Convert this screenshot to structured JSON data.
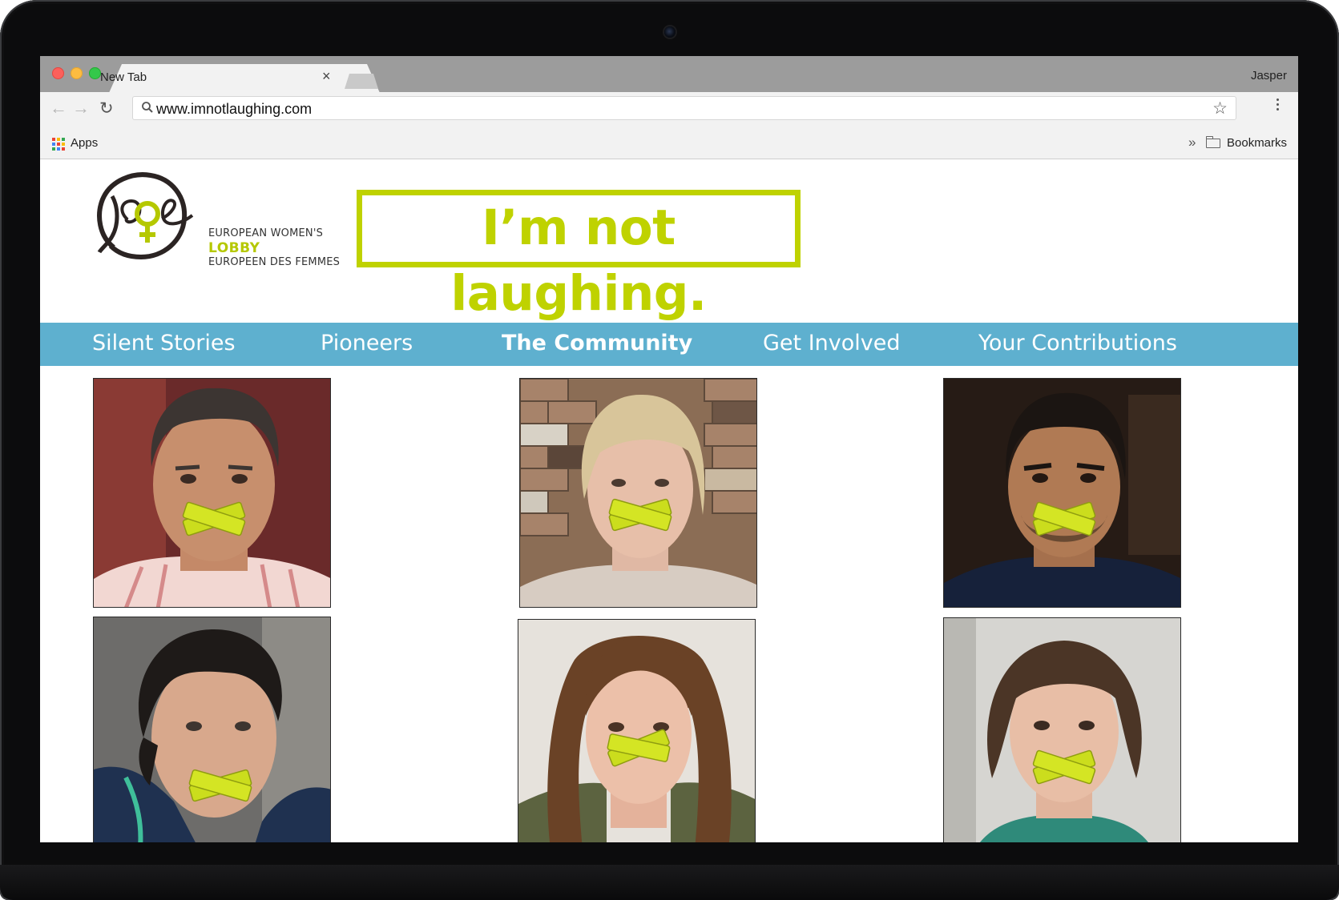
{
  "browser": {
    "tab_title": "New Tab",
    "tab_close": "×",
    "profile_name": "Jasper",
    "url": "www.imnotlaughing.com",
    "bookmarks_apps": "Apps",
    "bookmarks_overflow": "»",
    "bookmarks_folder": "Bookmarks"
  },
  "site": {
    "org_line1": "EUROPEAN WOMEN'S",
    "org_line2": "LOBBY",
    "org_line3": "EUROPEEN DES FEMMES",
    "tagline": "I’m not laughing.",
    "accent_color": "#bfd200",
    "nav_color": "#5eb0cf",
    "nav": [
      {
        "label": "Silent Stories",
        "active": false
      },
      {
        "label": "Pioneers",
        "active": false
      },
      {
        "label": "The Community",
        "active": true
      },
      {
        "label": "Get Involved",
        "active": false
      },
      {
        "label": "Your Contributions",
        "active": false
      }
    ],
    "portraits": [
      {
        "desc": "man with grey curly hair, tape over mouth"
      },
      {
        "desc": "blonde woman in front of brick wall, tape over mouth"
      },
      {
        "desc": "dark-haired man, tape over mouth"
      },
      {
        "desc": "short-haired woman, tape over mouth"
      },
      {
        "desc": "long-haired woman, tape over mouth"
      },
      {
        "desc": "bob-haired woman, tape over mouth"
      }
    ]
  }
}
